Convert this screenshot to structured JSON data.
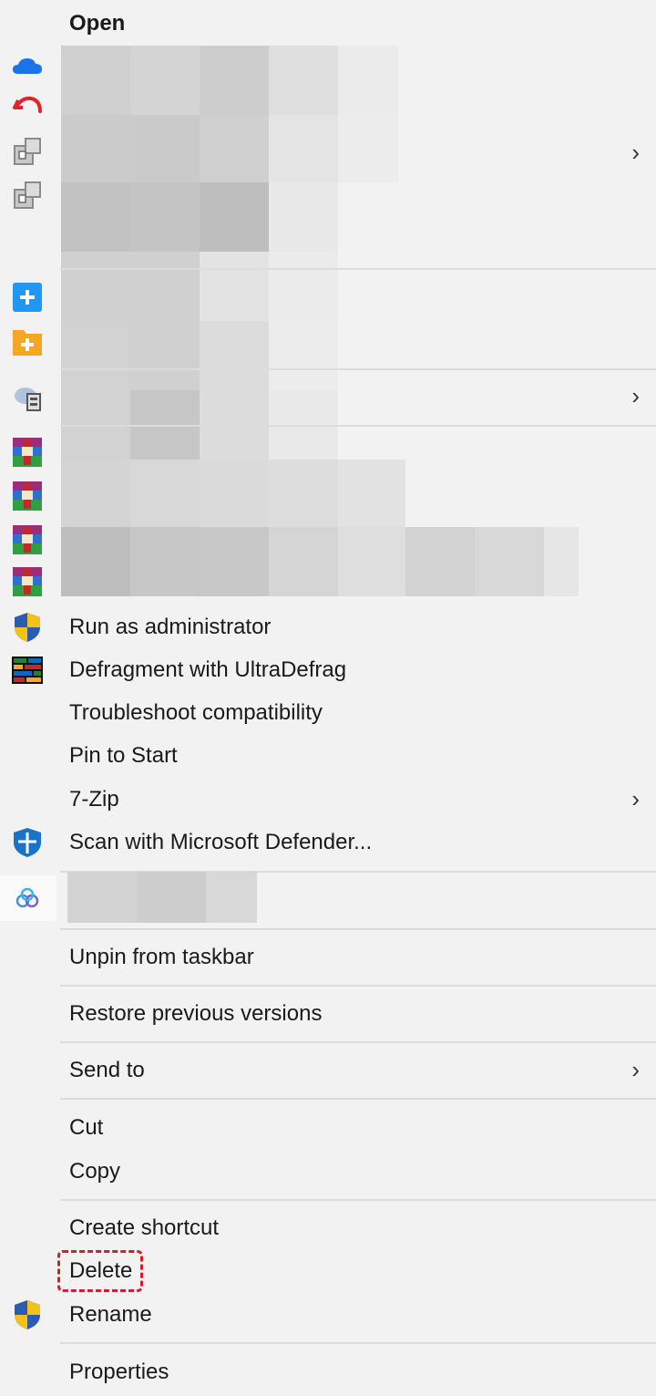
{
  "menu": {
    "open": "Open",
    "run_as_admin": "Run as administrator",
    "defragment": "Defragment with UltraDefrag",
    "troubleshoot": "Troubleshoot compatibility",
    "pin_to_start": "Pin to Start",
    "seven_zip": "7-Zip",
    "scan_defender": "Scan with Microsoft Defender...",
    "unpin_taskbar": "Unpin from taskbar",
    "restore_versions": "Restore previous versions",
    "send_to": "Send to",
    "cut": "Cut",
    "copy": "Copy",
    "create_shortcut": "Create shortcut",
    "delete": "Delete",
    "rename": "Rename",
    "properties": "Properties",
    "chevron": "›"
  },
  "icons": [
    "onedrive-cloud-icon",
    "undo-arrow-icon",
    "device-icon",
    "device-icon",
    "plus-square-icon",
    "folder-plus-icon",
    "network-device-icon",
    "winrar-icon",
    "winrar-icon",
    "winrar-icon",
    "winrar-icon",
    "uac-shield-icon",
    "ultradefrag-icon",
    "defender-shield-icon",
    "cloud-app-icon",
    "uac-shield-icon"
  ],
  "colors": {
    "background": "#f2f2f2",
    "separator": "#dcdcdc",
    "highlight": "#d0202c"
  }
}
